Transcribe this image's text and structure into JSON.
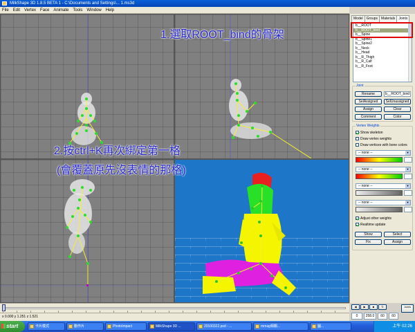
{
  "window": {
    "title": "MilkShape 3D 1.8.5 BETA 1 - C:\\Documents and Settings\\... 1.ms3d"
  },
  "menu": [
    "File",
    "Edit",
    "Vertex",
    "Face",
    "Animate",
    "Tools",
    "Window",
    "Help"
  ],
  "annotations": {
    "step1": "1.選取ROOT_bind的骨架",
    "step2_line1": "2.按ctrl+K再次綁定第一格",
    "step2_line2": "(會覆蓋原先沒表情的那格)"
  },
  "panel": {
    "tabs": [
      "Model",
      "Groups",
      "Materials",
      "Joints"
    ],
    "active_tab": "Joints",
    "joints": [
      "b__ROOT",
      "b__ROOT_bind",
      "b__Spine",
      "b__Spine1",
      "b__Spine2",
      "b__Neck",
      "b__Head",
      "b__R_Thigh",
      "b__R_Calf",
      "b__R_Foot"
    ],
    "selected_joint_index": 1,
    "joints_group": {
      "title": "Joint",
      "rename": "Rename",
      "name_value": "b__ROOT_bind",
      "sel_assigned": "SelAssigned",
      "sel_unassigned": "SelUnassigned",
      "assign": "Assign",
      "clear": "Clear",
      "comment": "Comment",
      "color": "Color"
    },
    "weights_group": {
      "title": "Vertex Weights",
      "show_skeleton": "Show skeleton",
      "draw_vertex_weights": "Draw vertex weights",
      "draw_vertices_bone_colors": "Draw vertices with bone colors",
      "none": "-- none --",
      "adjust_other": "Adjust other weights",
      "realtime": "Realtime update",
      "show": "Show",
      "select": "Select",
      "fix": "Fix",
      "assign": "Assign"
    }
  },
  "status": {
    "coords": "x 0.000 y 1.251 z 1.521"
  },
  "playback": {
    "frame": "0",
    "start": "258.0",
    "end": "60",
    "fps": "60",
    "joints_btn": "Joints"
  },
  "taskbar": {
    "start": "start",
    "tasks": [
      "卡片模式",
      "動作片",
      "PhotoImpact",
      "MilkShape 3D ...",
      "20100322.psd - ...",
      "mmag相關...",
      "圖..."
    ],
    "active_task": 3,
    "clock": "上午 02:26"
  },
  "colors": {
    "annotation": "#2a2ac8",
    "highlight_box": "#e00000",
    "viewport_gray": "#808080",
    "viewport_3d": "#1d76c8",
    "skin": "#f5f500",
    "head": "#e82020",
    "torso": "#28e028",
    "pants": "#e020e0",
    "bone": "#f5f032"
  }
}
